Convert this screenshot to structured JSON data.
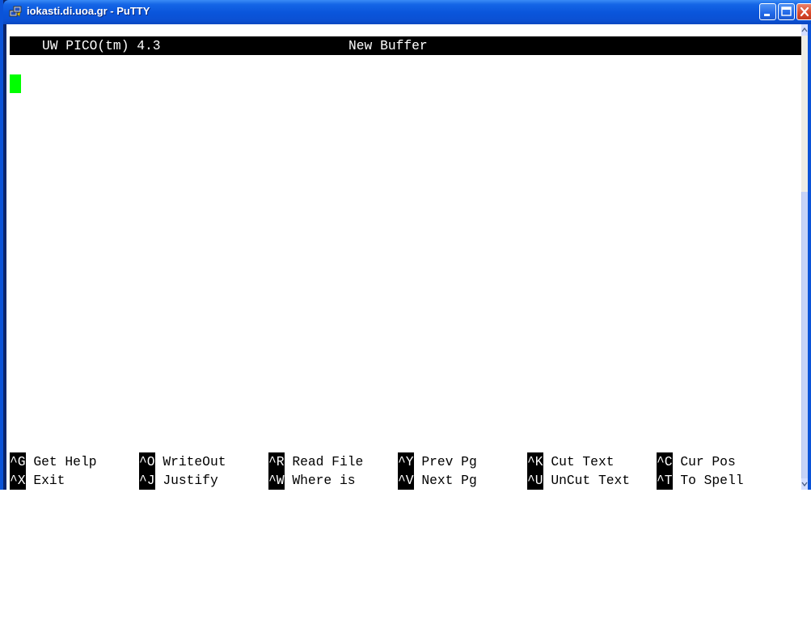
{
  "window": {
    "title": "iokasti.di.uoa.gr - PuTTY",
    "icon": "putty-terminal-icon"
  },
  "titlebar_buttons": {
    "minimize": "minimize-icon",
    "maximize": "maximize-icon",
    "close": "close-icon"
  },
  "editor": {
    "program": "UW PICO(tm) 4.3",
    "buffer_name": "New Buffer",
    "content": "",
    "cursor_color": "#00ff00"
  },
  "footer": {
    "row1": [
      {
        "key": "^G",
        "label": "Get Help"
      },
      {
        "key": "^O",
        "label": "WriteOut"
      },
      {
        "key": "^R",
        "label": "Read File"
      },
      {
        "key": "^Y",
        "label": "Prev Pg"
      },
      {
        "key": "^K",
        "label": "Cut Text"
      },
      {
        "key": "^C",
        "label": "Cur Pos"
      }
    ],
    "row2": [
      {
        "key": "^X",
        "label": "Exit"
      },
      {
        "key": "^J",
        "label": "Justify"
      },
      {
        "key": "^W",
        "label": "Where is"
      },
      {
        "key": "^V",
        "label": "Next Pg"
      },
      {
        "key": "^U",
        "label": "UnCut Text"
      },
      {
        "key": "^T",
        "label": "To Spell"
      }
    ]
  },
  "colors": {
    "titlebar": "#0a56dc",
    "terminal_bg": "#ffffff",
    "header_bg": "#000000",
    "cursor": "#00ff00"
  }
}
